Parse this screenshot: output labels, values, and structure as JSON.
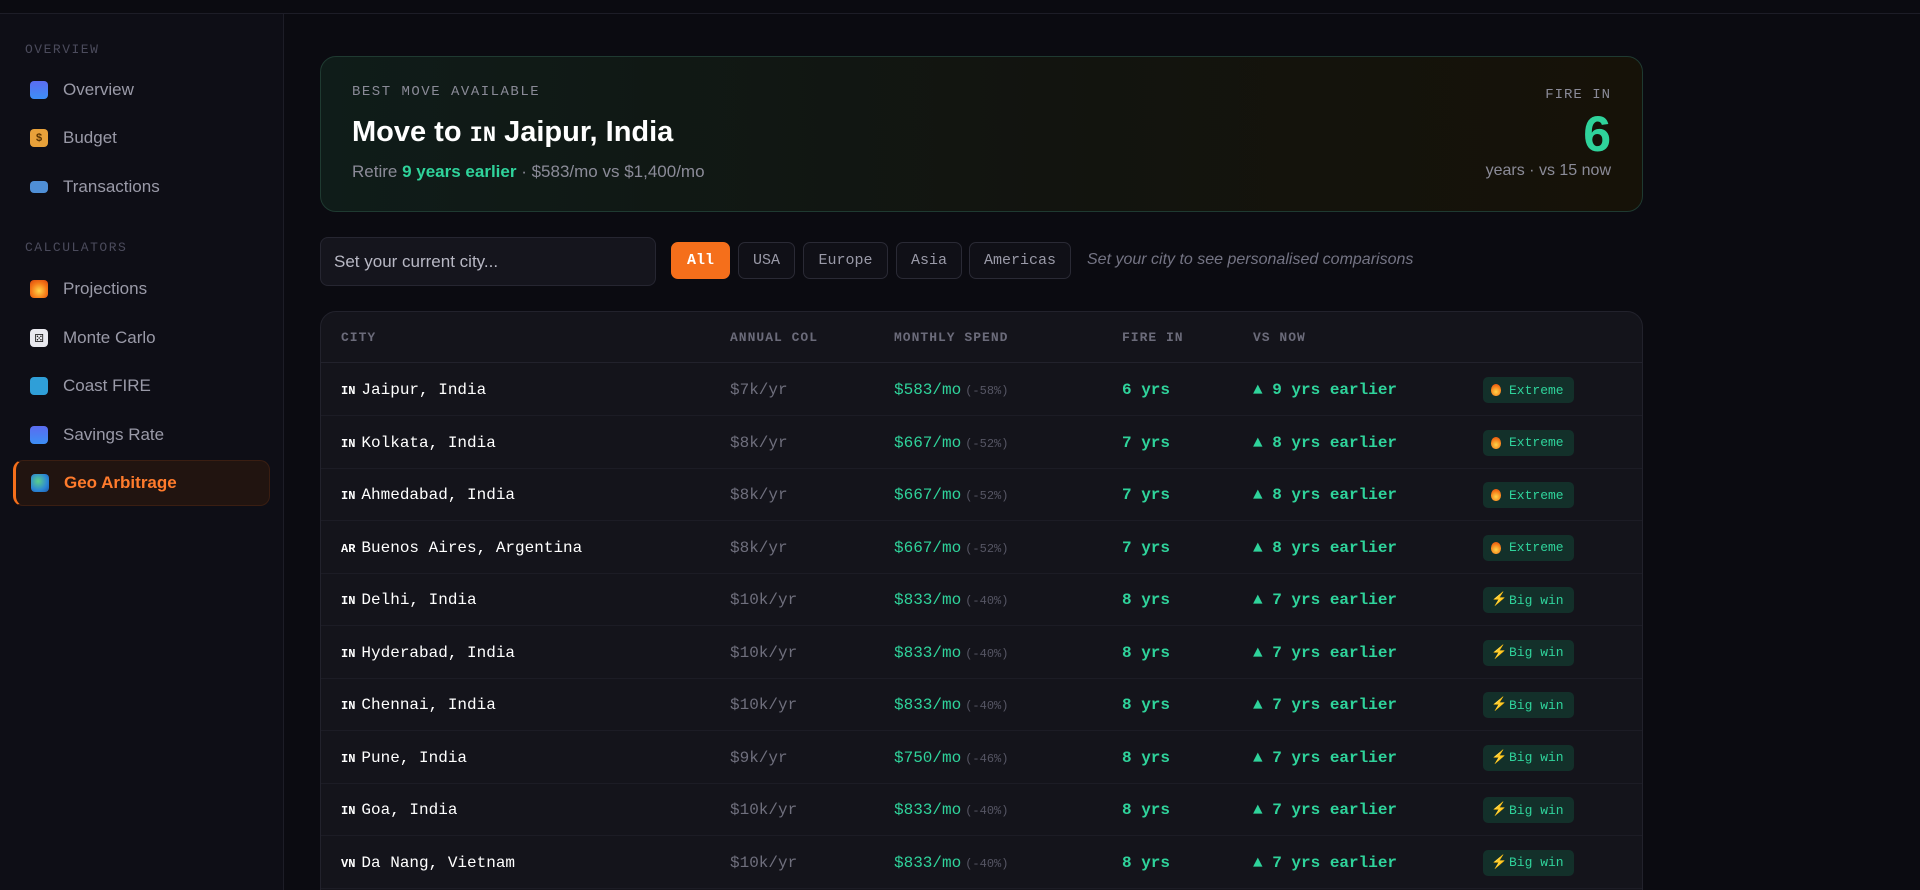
{
  "sidebar": {
    "overview_label": "OVERVIEW",
    "calculators_label": "CALCULATORS",
    "overview_items": [
      {
        "label": "Overview",
        "icon": "bar-chart-icon"
      },
      {
        "label": "Budget",
        "icon": "money-bag-icon"
      },
      {
        "label": "Transactions",
        "icon": "credit-card-icon"
      }
    ],
    "calculator_items": [
      {
        "label": "Projections",
        "icon": "fire-icon"
      },
      {
        "label": "Monte Carlo",
        "icon": "dice-icon"
      },
      {
        "label": "Coast FIRE",
        "icon": "surfer-icon"
      },
      {
        "label": "Savings Rate",
        "icon": "bar-chart-icon"
      },
      {
        "label": "Geo Arbitrage",
        "icon": "globe-icon",
        "active": true
      }
    ]
  },
  "hero": {
    "kicker": "BEST MOVE AVAILABLE",
    "title_prefix": "Move to",
    "flag": "IN",
    "city": "Jaipur, India",
    "sub_prefix": "Retire",
    "sub_highlight": "9 years earlier",
    "sub_suffix": "· $583/mo vs $1,400/mo",
    "fire_label": "FIRE IN",
    "fire_value": "6",
    "fire_sub": "years · vs 15 now"
  },
  "filters": {
    "city_placeholder": "Set your current city...",
    "chips": [
      "All",
      "USA",
      "Europe",
      "Asia",
      "Americas"
    ],
    "active_chip": "All",
    "hint": "Set your city to see personalised comparisons"
  },
  "table": {
    "headers": [
      "CITY",
      "ANNUAL COL",
      "MONTHLY SPEND",
      "FIRE IN",
      "VS NOW"
    ],
    "rows": [
      {
        "flag": "IN",
        "city": "Jaipur, India",
        "col": "$7k/yr",
        "spend": "$583/mo",
        "pct": "(-58%)",
        "fire": "6 yrs",
        "vs": "▲ 9 yrs earlier",
        "badge": "Extreme",
        "badge_icon": "fire"
      },
      {
        "flag": "IN",
        "city": "Kolkata, India",
        "col": "$8k/yr",
        "spend": "$667/mo",
        "pct": "(-52%)",
        "fire": "7 yrs",
        "vs": "▲ 8 yrs earlier",
        "badge": "Extreme",
        "badge_icon": "fire"
      },
      {
        "flag": "IN",
        "city": "Ahmedabad, India",
        "col": "$8k/yr",
        "spend": "$667/mo",
        "pct": "(-52%)",
        "fire": "7 yrs",
        "vs": "▲ 8 yrs earlier",
        "badge": "Extreme",
        "badge_icon": "fire"
      },
      {
        "flag": "AR",
        "city": "Buenos Aires, Argentina",
        "col": "$8k/yr",
        "spend": "$667/mo",
        "pct": "(-52%)",
        "fire": "7 yrs",
        "vs": "▲ 8 yrs earlier",
        "badge": "Extreme",
        "badge_icon": "fire"
      },
      {
        "flag": "IN",
        "city": "Delhi, India",
        "col": "$10k/yr",
        "spend": "$833/mo",
        "pct": "(-40%)",
        "fire": "8 yrs",
        "vs": "▲ 7 yrs earlier",
        "badge": "Big win",
        "badge_icon": "bolt"
      },
      {
        "flag": "IN",
        "city": "Hyderabad, India",
        "col": "$10k/yr",
        "spend": "$833/mo",
        "pct": "(-40%)",
        "fire": "8 yrs",
        "vs": "▲ 7 yrs earlier",
        "badge": "Big win",
        "badge_icon": "bolt"
      },
      {
        "flag": "IN",
        "city": "Chennai, India",
        "col": "$10k/yr",
        "spend": "$833/mo",
        "pct": "(-40%)",
        "fire": "8 yrs",
        "vs": "▲ 7 yrs earlier",
        "badge": "Big win",
        "badge_icon": "bolt"
      },
      {
        "flag": "IN",
        "city": "Pune, India",
        "col": "$9k/yr",
        "spend": "$750/mo",
        "pct": "(-46%)",
        "fire": "8 yrs",
        "vs": "▲ 7 yrs earlier",
        "badge": "Big win",
        "badge_icon": "bolt"
      },
      {
        "flag": "IN",
        "city": "Goa, India",
        "col": "$10k/yr",
        "spend": "$833/mo",
        "pct": "(-40%)",
        "fire": "8 yrs",
        "vs": "▲ 7 yrs earlier",
        "badge": "Big win",
        "badge_icon": "bolt"
      },
      {
        "flag": "VN",
        "city": "Da Nang, Vietnam",
        "col": "$10k/yr",
        "spend": "$833/mo",
        "pct": "(-40%)",
        "fire": "8 yrs",
        "vs": "▲ 7 yrs earlier",
        "badge": "Big win",
        "badge_icon": "bolt"
      }
    ]
  },
  "colors": {
    "accent": "#f56f1b",
    "positive": "#2fd39b",
    "background": "#0b0b11"
  }
}
